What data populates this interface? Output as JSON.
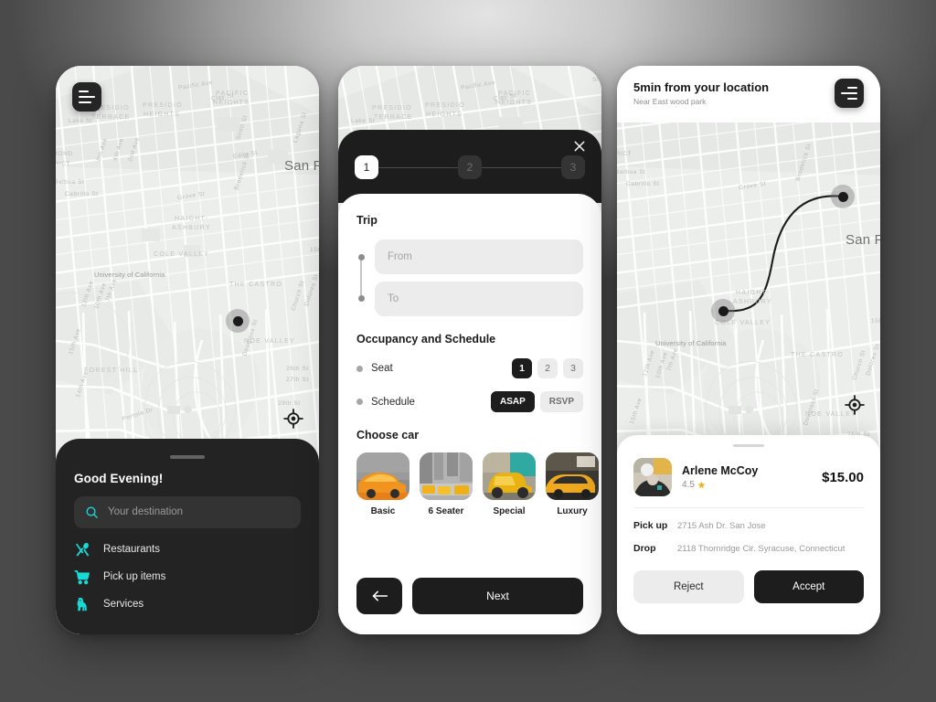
{
  "accent": "#17d9d6",
  "dark": "#1d1d1d",
  "map": {
    "labels": [
      "PACIFIC HEIGHTS",
      "PRESIDIO TERRACE",
      "PRESIDIO HEIGHTS",
      "Lake St",
      "Pacific Ave",
      "Clay St",
      "Eddy St",
      "Scott St",
      "Laguna St",
      "Broderick St",
      "Balboa St",
      "Cabrillo St",
      "Grove St",
      "2nd Ave",
      "4th Ave",
      "8th Ave",
      "RICHMOND DISTRICT",
      "San Francisco",
      "HAIGHT-ASHBURY",
      "COLE VALLEY",
      "University of California",
      "THE CASTRO",
      "NOE VALLEY",
      "FOREST HILL",
      "Dolores St",
      "Church St",
      "Douglass St",
      "7th Ave",
      "10th Ave",
      "12th Ave",
      "15th Ave",
      "14th Ave",
      "26th St",
      "27th St",
      "29th St",
      "Portola Dr",
      "15th St"
    ],
    "city_label": "San F",
    "menu_icon": "hamburger-menu-icon",
    "gps_icon": "gps-crosshair-icon"
  },
  "phone1": {
    "greeting": "Good Evening!",
    "search": {
      "placeholder": "Your destination",
      "icon": "search-icon"
    },
    "services": [
      {
        "label": "Restaurants",
        "icon": "restaurant-icon"
      },
      {
        "label": "Pick up items",
        "icon": "shopping-cart-icon"
      },
      {
        "label": "Services",
        "icon": "dog-icon"
      }
    ]
  },
  "phone2": {
    "close_icon": "close-icon",
    "steps": [
      {
        "label": "1",
        "active": true
      },
      {
        "label": "2",
        "active": false
      },
      {
        "label": "3",
        "active": false
      }
    ],
    "trip": {
      "title": "Trip",
      "from_placeholder": "From",
      "to_placeholder": "To"
    },
    "occupancy": {
      "title": "Occupancy and Schedule",
      "seat_label": "Seat",
      "seat_options": [
        "1",
        "2",
        "3"
      ],
      "seat_selected": "1",
      "schedule_label": "Schedule",
      "schedule_options": [
        "ASAP",
        "RSVP"
      ],
      "schedule_selected": "ASAP"
    },
    "choose_car": {
      "title": "Choose car",
      "options": [
        {
          "label": "Basic",
          "image": "orange-taxi-photo"
        },
        {
          "label": "6 Seater",
          "image": "taxi-fleet-street-photo"
        },
        {
          "label": "Special",
          "image": "vintage-yellow-truck-photo"
        },
        {
          "label": "Luxury",
          "image": "yellow-luxury-cab-photo"
        }
      ]
    },
    "back_label": "back-arrow-icon",
    "next_label": "Next"
  },
  "phone3": {
    "header": {
      "title": "5min from your location",
      "subtitle": "Near East wood park",
      "menu_icon": "hamburger-menu-icon"
    },
    "driver": {
      "name": "Arlene McCoy",
      "rating": "4.5",
      "star_icon": "star-icon",
      "price": "$15.00",
      "avatar": "driver-photo"
    },
    "pickup_label": "Pick up",
    "pickup_value": "2715 Ash Dr. San Jose",
    "drop_label": "Drop",
    "drop_value": "2118 Thornridge Cir. Syracuse, Connecticut",
    "reject_label": "Reject",
    "accept_label": "Accept"
  }
}
